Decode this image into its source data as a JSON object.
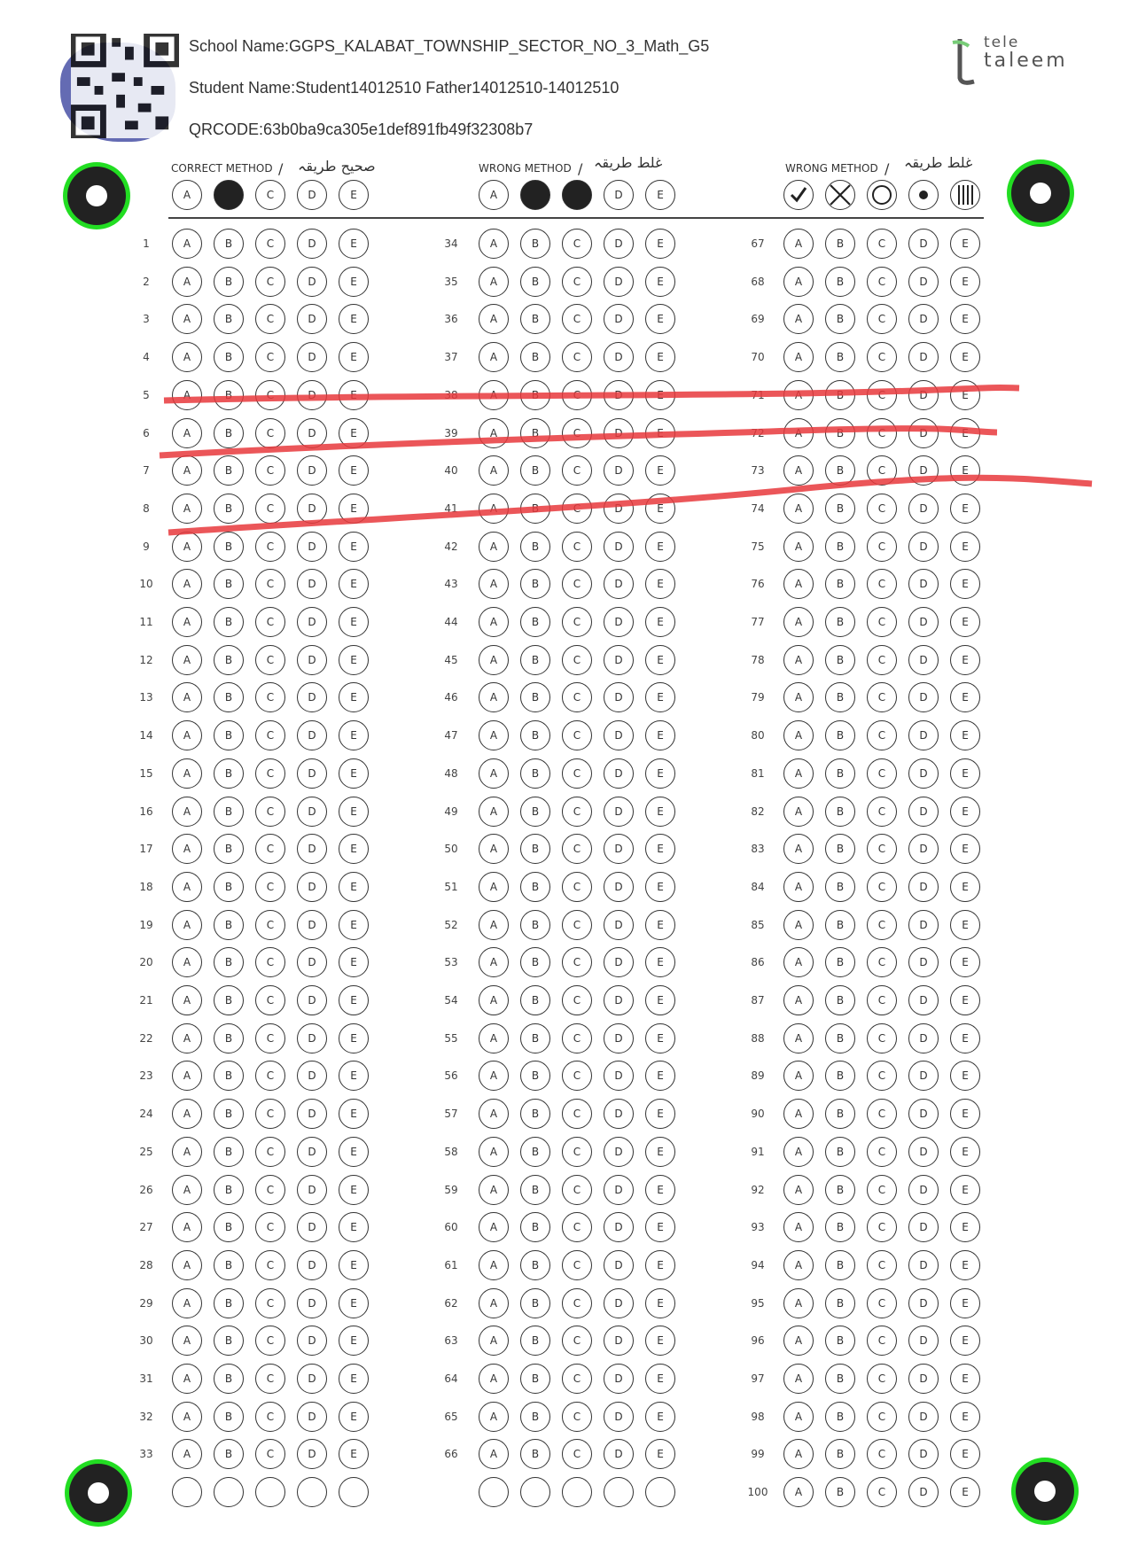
{
  "header": {
    "school": "School Name:GGPS_KALABAT_TOWNSHIP_SECTOR_NO_3_Math_G5",
    "student": "Student Name:Student14012510 Father14012510-14012510",
    "qrcode": "QRCODE:63b0ba9ca305e1def891fb49f32308b7"
  },
  "logo": {
    "line1": "tele",
    "line2": "taleem"
  },
  "legend": {
    "correct_label": "CORRECT METHOD",
    "correct_arabic": "صحیح طریقہ",
    "wrong_label": "WRONG METHOD",
    "wrong_arabic": "غلط طریقہ",
    "separator": "/"
  },
  "options": [
    "A",
    "B",
    "C",
    "D",
    "E"
  ],
  "columns": [
    {
      "start": 1,
      "end": 33
    },
    {
      "start": 34,
      "end": 66
    },
    {
      "start": 67,
      "end": 100
    }
  ],
  "colors": {
    "marker_ring": "#22dd22",
    "strike": "#e8383c"
  }
}
